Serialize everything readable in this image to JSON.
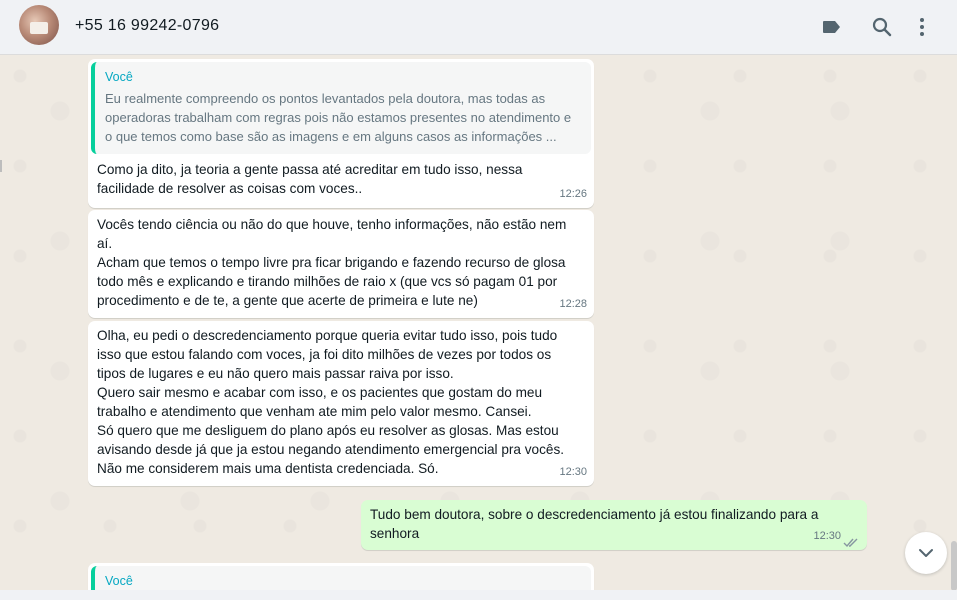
{
  "header": {
    "contact_name": "+55 16 99242-0796",
    "icons": [
      "label-icon",
      "search-icon",
      "more-vertical-icon"
    ]
  },
  "messages": [
    {
      "direction": "incoming",
      "quote": {
        "author": "Você",
        "text": "Eu realmente compreendo os pontos levantados pela doutora, mas todas as\noperadoras trabalham com regras pois não estamos presentes no atendimento e\no que temos como base são as imagens e em alguns casos as informações ..."
      },
      "text": "Como ja dito, ja teoria a gente passa até acreditar em tudo isso, nessa\nfacilidade de resolver as coisas com voces..",
      "time": "12:26"
    },
    {
      "direction": "incoming",
      "text": "Vocês tendo ciência ou não do que houve, tenho informações, não estão nem\naí.\nAcham que temos o tempo livre pra ficar brigando e fazendo recurso de glosa\ntodo mês e explicando e tirando milhões de raio x (que vcs só pagam 01 por\nprocedimento e de te, a gente que acerte de primeira e lute ne)",
      "time": "12:28"
    },
    {
      "direction": "incoming",
      "text": "Olha, eu pedi o descredenciamento porque queria evitar tudo isso, pois tudo\nisso que estou falando com voces, ja foi dito milhões de vezes por todos os\ntipos de lugares e eu não quero mais passar raiva por isso.\nQuero sair mesmo e acabar com isso, e os pacientes que gostam do meu\ntrabalho e atendimento que venham ate mim pelo valor mesmo. Cansei.\nSó quero que me desliguem do plano após eu resolver as glosas. Mas estou\navisando desde já que ja estou negando atendimento emergencial pra vocês.\nNão me considerem mais uma dentista credenciada. Só.",
      "time": "12:30"
    },
    {
      "direction": "outgoing",
      "text": "Tudo bem doutora, sobre o descredenciamento já estou finalizando para a\nsenhora",
      "time": "12:30",
      "status": "read"
    },
    {
      "direction": "incoming",
      "quote": {
        "author": "Você"
      }
    }
  ],
  "colors": {
    "chat_background": "#efeae2",
    "incoming_bubble": "#ffffff",
    "outgoing_bubble": "#d9fdd3",
    "quote_bar": "#06cf9c",
    "quote_author": "#06a8c2",
    "read_ticks": "#8696a0"
  }
}
